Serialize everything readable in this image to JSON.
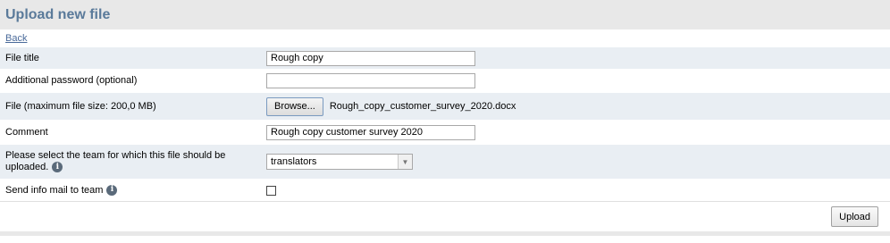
{
  "page_title": "Upload new file",
  "back_link": "Back",
  "form": {
    "file_title": {
      "label": "File title",
      "value": "Rough copy"
    },
    "password": {
      "label": "Additional password (optional)",
      "value": ""
    },
    "file": {
      "label": "File (maximum file size: 200,0 MB)",
      "browse_label": "Browse...",
      "file_name": "Rough_copy_customer_survey_2020.docx"
    },
    "comment": {
      "label": "Comment",
      "value": "Rough copy customer survey 2020"
    },
    "team": {
      "label": "Please select the team for which this file should be uploaded.",
      "selected": "translators"
    },
    "send_mail": {
      "label": "Send info mail to team",
      "checked": false
    }
  },
  "upload_label": "Upload",
  "icons": {
    "info": "info-icon",
    "dropdown": "chevron-down-icon"
  },
  "colors": {
    "title": "#5a7a9a",
    "row_alt": "#e9eef3",
    "header_bg": "#e8e8e8",
    "link": "#4a6a9a"
  }
}
